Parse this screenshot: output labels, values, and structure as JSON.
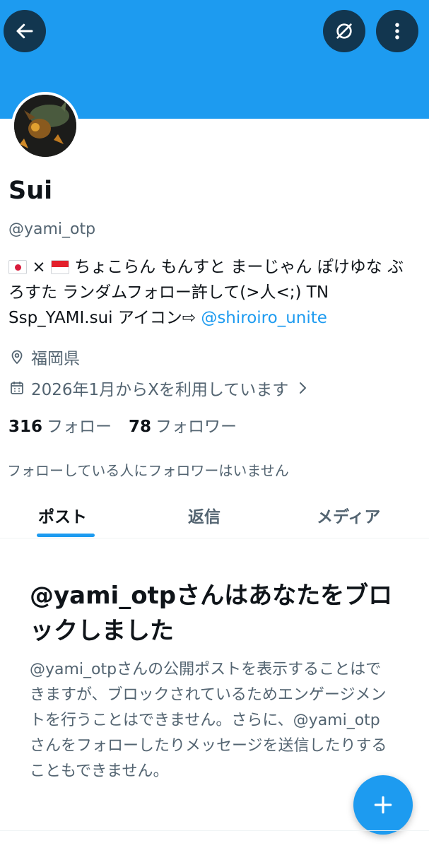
{
  "profile": {
    "name": "Sui",
    "handle": "@yami_otp",
    "bio_text_1": " ちょこらん もんすと まーじゃん ぽけゆな ぶろすた ランダムフォロー許して(>人<;) TN Ssp_YAMI.sui アイコン⇨ ",
    "bio_link": "@shiroiro_unite",
    "bio_flags": [
      "japan-flag",
      "indonesia-flag"
    ],
    "bio_separator": "×",
    "location": "福岡県",
    "joined": "2026年1月からXを利用しています",
    "following_count": "316",
    "following_label": "フォロー",
    "followers_count": "78",
    "followers_label": "フォロワー",
    "no_followers_you_know": "フォローしている人にフォロワーはいません"
  },
  "tabs": [
    {
      "label": "ポスト",
      "active": true
    },
    {
      "label": "返信",
      "active": false
    },
    {
      "label": "メディア",
      "active": false
    }
  ],
  "blocked": {
    "title": "@yami_otpさんはあなたをブロックしました",
    "body": "@yami_otpさんの公開ポストを表示することはできますが、ブロックされているためエンゲージメントを行うことはできません。さらに、@yami_otpさんをフォローしたりメッセージを送信したりすることもできません。"
  },
  "icons": {
    "back": "arrow-left-icon",
    "mute": "mute-icon",
    "more": "more-vertical-icon",
    "location": "location-pin-icon",
    "calendar": "calendar-icon",
    "chevron": "chevron-right-icon",
    "compose": "plus-icon"
  },
  "colors": {
    "accent": "#1d9bf0",
    "text_primary": "#0f1419",
    "text_secondary": "#536471"
  }
}
